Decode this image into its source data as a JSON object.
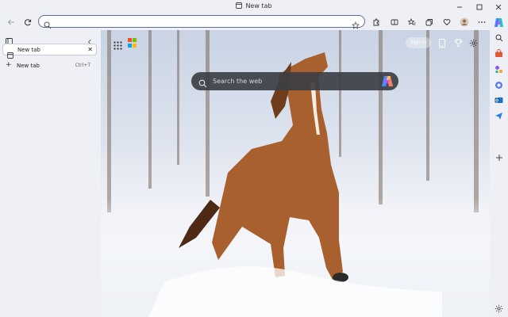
{
  "window": {
    "title": "New tab"
  },
  "toolbar": {
    "address_value": "",
    "address_placeholder": ""
  },
  "vertical_tabs": {
    "tabs": [
      {
        "label": "New tab"
      }
    ],
    "new_tab_label": "New tab",
    "new_tab_shortcut": "Ctrl+T"
  },
  "newtab_page": {
    "sign_in_label": "Sign in",
    "search_placeholder": "Search the web"
  },
  "colors": {
    "accent": "#5b6d9a",
    "search_bg": "#3d3f45",
    "chrome_bg": "#eef0f5"
  }
}
